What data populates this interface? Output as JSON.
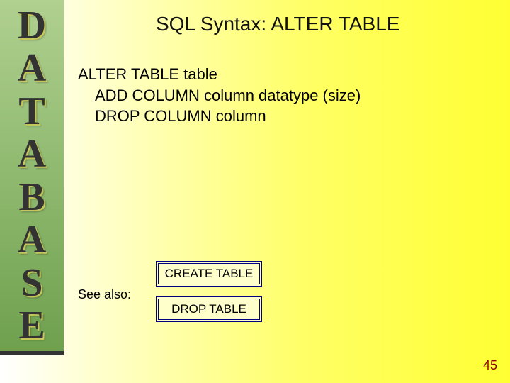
{
  "sidebar": {
    "letters": [
      "D",
      "A",
      "T",
      "A",
      "B",
      "A",
      "S",
      "E"
    ]
  },
  "title": "SQL Syntax: ALTER TABLE",
  "syntax": {
    "line1": "ALTER TABLE table",
    "line2": "ADD COLUMN column datatype (size)",
    "line3": "DROP COLUMN column"
  },
  "see_also": {
    "label": "See also:",
    "items": [
      "CREATE TABLE",
      "DROP TABLE"
    ]
  },
  "page_number": "45"
}
